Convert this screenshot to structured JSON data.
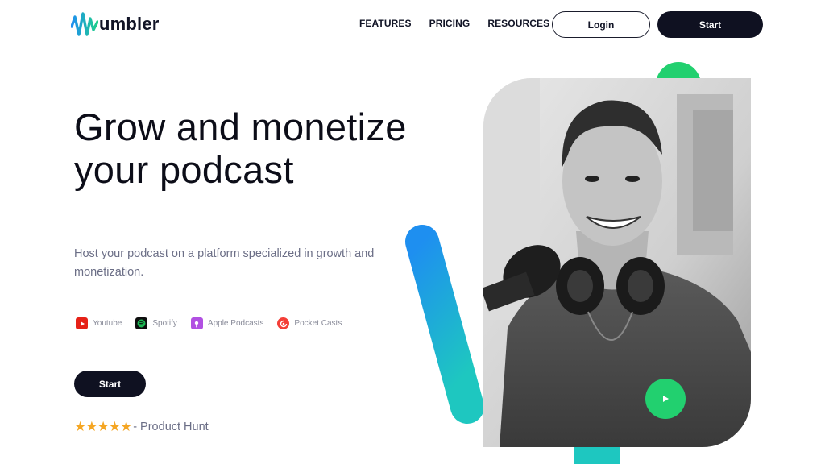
{
  "header": {
    "logo_text": "umbler",
    "nav": [
      {
        "label": "FEATURES"
      },
      {
        "label": "PRICING"
      },
      {
        "label": "RESOURCES",
        "has_dropdown": true
      }
    ],
    "login_label": "Login",
    "start_label": "Start"
  },
  "hero": {
    "title": "Grow and monetize your podcast",
    "subtitle": "Host your podcast on a platform specialized in growth and monetization.",
    "platforms": [
      {
        "label": "Youtube",
        "icon": "youtube-icon",
        "color": "#e62117"
      },
      {
        "label": "Spotify",
        "icon": "spotify-icon",
        "color": "#1db954"
      },
      {
        "label": "Apple Podcasts",
        "icon": "apple-podcasts-icon",
        "color": "#b150e2"
      },
      {
        "label": "Pocket Casts",
        "icon": "pocket-casts-icon",
        "color": "#f43e37"
      }
    ],
    "start_label": "Start",
    "rating_stars": "★★★★★",
    "rating_text": "- Product Hunt"
  },
  "colors": {
    "primary_dark": "#0f1121",
    "accent_green": "#22d06f",
    "accent_blue": "#1e8ff0",
    "accent_teal": "#1ec7c0",
    "star": "#f5a623"
  }
}
